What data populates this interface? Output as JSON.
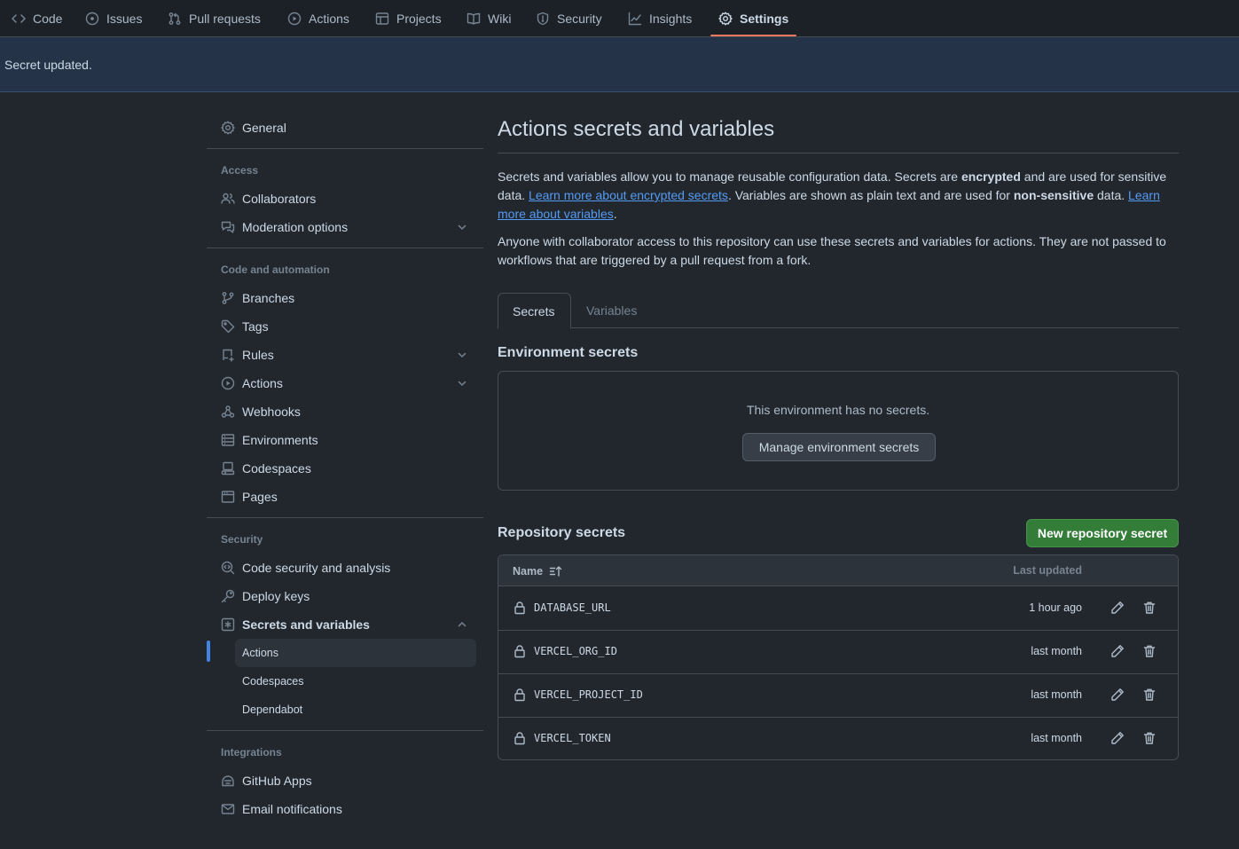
{
  "topnav": {
    "tabs": [
      {
        "label": "Code",
        "icon": "code-icon"
      },
      {
        "label": "Issues",
        "icon": "issue-opened-icon"
      },
      {
        "label": "Pull requests",
        "icon": "git-pull-request-icon"
      },
      {
        "label": "Actions",
        "icon": "play-icon"
      },
      {
        "label": "Projects",
        "icon": "table-icon"
      },
      {
        "label": "Wiki",
        "icon": "book-icon"
      },
      {
        "label": "Security",
        "icon": "shield-icon"
      },
      {
        "label": "Insights",
        "icon": "graph-icon"
      },
      {
        "label": "Settings",
        "icon": "gear-icon"
      }
    ],
    "active_tab": "Settings",
    "accent_color": "#ec775c"
  },
  "flash": {
    "message": "Secret updated."
  },
  "sidebar": {
    "general": "General",
    "sections": {
      "access": "Access",
      "code_automation": "Code and automation",
      "security": "Security",
      "integrations": "Integrations"
    },
    "items": {
      "collaborators": "Collaborators",
      "moderation": "Moderation options",
      "branches": "Branches",
      "tags": "Tags",
      "rules": "Rules",
      "actions": "Actions",
      "webhooks": "Webhooks",
      "environments": "Environments",
      "codespaces": "Codespaces",
      "pages": "Pages",
      "code_security": "Code security and analysis",
      "deploy_keys": "Deploy keys",
      "secrets_variables": "Secrets and variables",
      "github_apps": "GitHub Apps",
      "email_notifications": "Email notifications"
    },
    "sub_items": {
      "actions": "Actions",
      "codespaces": "Codespaces",
      "dependabot": "Dependabot"
    },
    "selected_sub_item": "Actions",
    "selection_color": "#4184e4"
  },
  "main": {
    "title": "Actions secrets and variables",
    "intro": {
      "p1_a": "Secrets and variables allow you to manage reusable configuration data. Secrets are ",
      "p1_b": "encrypted",
      "p1_c": " and are used for sensitive data. ",
      "p1_link1": "Learn more about encrypted secrets",
      "p1_d": ". Variables are shown as plain text and are used for ",
      "p1_e": "non-sensitive",
      "p1_f": " data. ",
      "p1_link2": "Learn more about variables",
      "p1_g": ".",
      "p2": "Anyone with collaborator access to this repository can use these secrets and variables for actions. They are not passed to workflows that are triggered by a pull request from a fork."
    },
    "tabs": {
      "secrets": "Secrets",
      "variables": "Variables",
      "active": "Secrets"
    },
    "environment": {
      "heading": "Environment secrets",
      "empty_message": "This environment has no secrets.",
      "manage_button": "Manage environment secrets"
    },
    "repository": {
      "heading": "Repository secrets",
      "new_button": "New repository secret",
      "columns": {
        "name": "Name",
        "updated": "Last updated"
      },
      "secrets": [
        {
          "name": "DATABASE_URL",
          "updated": "1 hour ago"
        },
        {
          "name": "VERCEL_ORG_ID",
          "updated": "last month"
        },
        {
          "name": "VERCEL_PROJECT_ID",
          "updated": "last month"
        },
        {
          "name": "VERCEL_TOKEN",
          "updated": "last month"
        }
      ]
    },
    "primary_button_color": "#347d39",
    "link_color": "#539bf5"
  }
}
